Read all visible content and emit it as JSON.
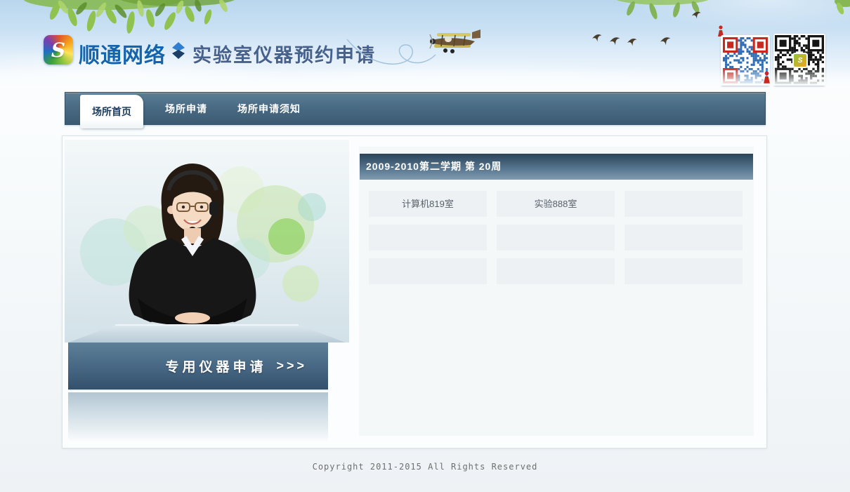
{
  "header": {
    "brand": "顺通网络",
    "logo_letter": "S",
    "title": "实验室仪器预约申请",
    "icons": [
      "shuntong-logo",
      "diamond-separator",
      "blue-qr-code",
      "black-qr-code",
      "red-person-markers"
    ]
  },
  "decorations": [
    "green-leaves-left",
    "green-leaves-right",
    "corner-leaf",
    "biplane",
    "flying-birds",
    "swirl-line",
    "service-agent-photo"
  ],
  "nav": {
    "tabs": [
      {
        "label": "场所首页",
        "active": true
      },
      {
        "label": "场所申请",
        "active": false
      },
      {
        "label": "场所申请须知",
        "active": false
      }
    ]
  },
  "promo": {
    "banner_label": "专用仪器申请",
    "banner_arrows": ">>>"
  },
  "schedule": {
    "title": "2009-2010第二学期 第 20周",
    "cells": [
      [
        "计算机819室",
        "实验888室",
        ""
      ],
      [
        "",
        "",
        ""
      ],
      [
        "",
        "",
        ""
      ]
    ]
  },
  "footer": {
    "copyright": "Copyright 2011-2015 All Rights Reserved"
  },
  "colors": {
    "brand_blue": "#1464ad",
    "title_slate": "#46618c",
    "nav_slate": "#3c5a72",
    "banner_slate": "#33506b",
    "qr_blue": "#2f6cb3",
    "qr_red": "#c8281e",
    "qr_black": "#151515",
    "cell_bg": "#edf1f4"
  }
}
